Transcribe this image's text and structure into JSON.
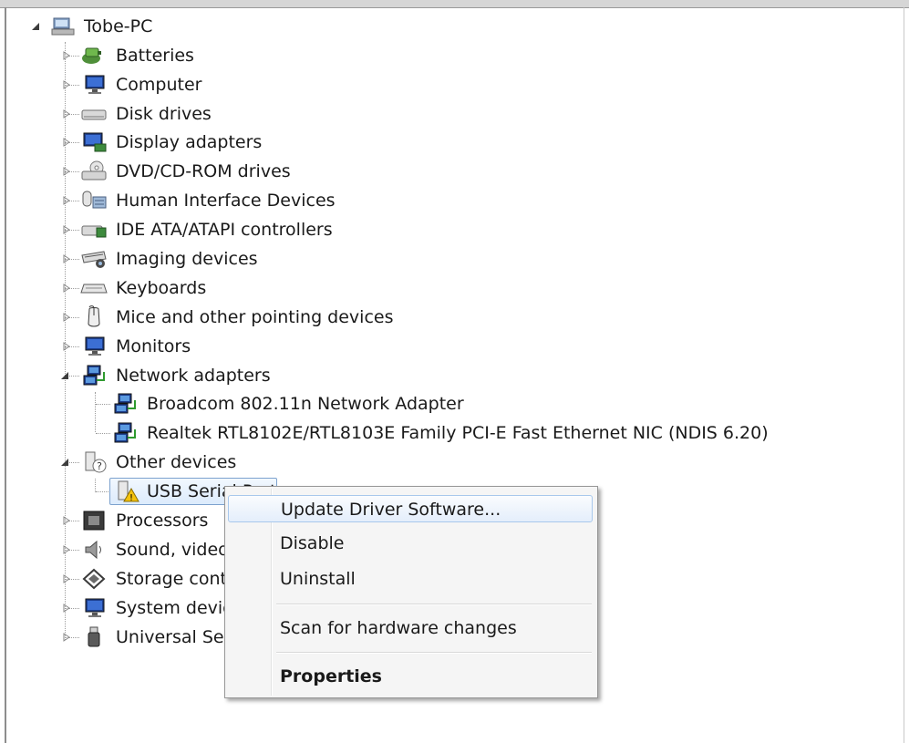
{
  "root": {
    "label": "Tobe-PC"
  },
  "categories": [
    {
      "label": "Batteries"
    },
    {
      "label": "Computer"
    },
    {
      "label": "Disk drives"
    },
    {
      "label": "Display adapters"
    },
    {
      "label": "DVD/CD-ROM drives"
    },
    {
      "label": "Human Interface Devices"
    },
    {
      "label": "IDE ATA/ATAPI controllers"
    },
    {
      "label": "Imaging devices"
    },
    {
      "label": "Keyboards"
    },
    {
      "label": "Mice and other pointing devices"
    },
    {
      "label": "Monitors"
    },
    {
      "label": "Network adapters",
      "children": [
        {
          "label": "Broadcom 802.11n Network Adapter"
        },
        {
          "label": "Realtek RTL8102E/RTL8103E Family PCI-E Fast Ethernet NIC (NDIS 6.20)"
        }
      ]
    },
    {
      "label": "Other devices",
      "children": [
        {
          "label": "USB Serial Port"
        }
      ]
    },
    {
      "label": "Processors"
    },
    {
      "label": "Sound, video and game controllers"
    },
    {
      "label": "Storage controllers"
    },
    {
      "label": "System devices"
    },
    {
      "label": "Universal Serial Bus controllers"
    }
  ],
  "context_menu": {
    "items": [
      {
        "label": "Update Driver Software..."
      },
      {
        "label": "Disable"
      },
      {
        "label": "Uninstall"
      },
      {
        "label": "Scan for hardware changes"
      },
      {
        "label": "Properties"
      }
    ]
  },
  "icons": {
    "computer": "computer-icon",
    "battery": "battery-icon",
    "monitor": "monitor-icon",
    "drive": "disk-drive-icon",
    "display": "display-adapter-icon",
    "dvd": "dvd-drive-icon",
    "hid": "hid-icon",
    "ide": "ide-controller-icon",
    "imaging": "scanner-icon",
    "keyboard": "keyboard-icon",
    "mouse": "mouse-icon",
    "network": "network-adapter-icon",
    "unknown": "unknown-device-icon",
    "warning": "warning-device-icon",
    "processor": "processor-icon",
    "sound": "speaker-icon",
    "storage": "storage-controller-icon",
    "usb": "usb-icon"
  }
}
